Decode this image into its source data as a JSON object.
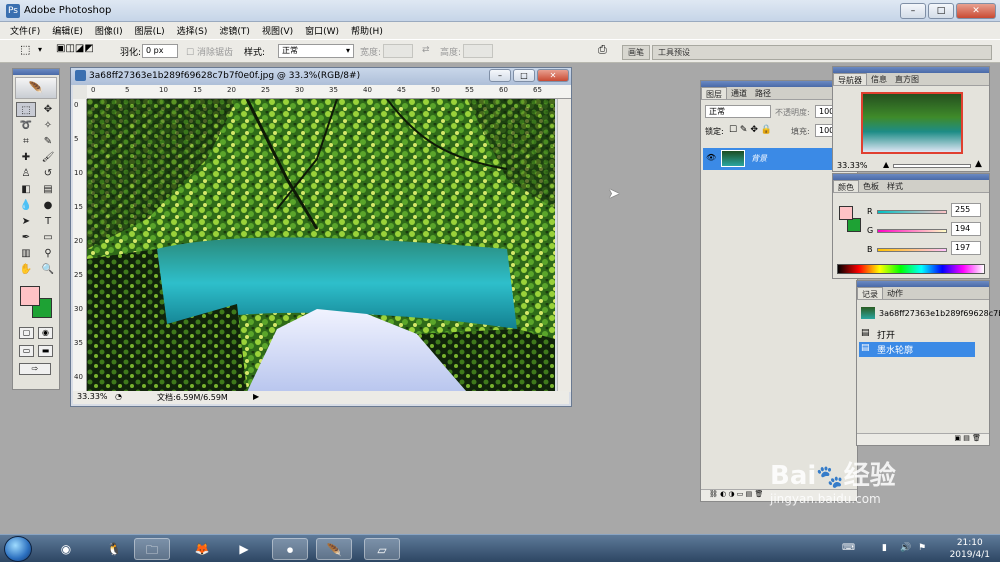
{
  "app": {
    "title": "Adobe Photoshop",
    "window_buttons": [
      "–",
      "□",
      "✕"
    ]
  },
  "menu": [
    "文件(F)",
    "编辑(E)",
    "图像(I)",
    "图层(L)",
    "选择(S)",
    "滤镜(T)",
    "视图(V)",
    "窗口(W)",
    "帮助(H)"
  ],
  "options": {
    "feather_label": "羽化:",
    "feather_value": "0 px",
    "antialias_label": "消除锯齿",
    "style_label": "样式:",
    "style_value": "正常",
    "width_label": "宽度:",
    "height_label": "高度:",
    "wells": [
      "画笔",
      "工具预设"
    ]
  },
  "document": {
    "title": "3a68ff27363e1b289f69628c7b7f0e0f.jpg @ 33.3%(RGB/8#)",
    "zoom": "33.33%",
    "doc_info": "文档:6.59M/6.59M",
    "ruler_h": [
      "0",
      "5",
      "10",
      "15",
      "20",
      "25",
      "30",
      "35",
      "40",
      "45",
      "50",
      "55",
      "60",
      "65"
    ],
    "ruler_v": [
      "0",
      "5",
      "10",
      "15",
      "20",
      "25",
      "30",
      "35",
      "40"
    ]
  },
  "layers_panel": {
    "tabs": [
      "图层",
      "通道",
      "路径"
    ],
    "blend_mode": "正常",
    "opacity_label": "不透明度:",
    "opacity_value": "100",
    "lock_label": "锁定:",
    "fill_label": "填充:",
    "fill_value": "100",
    "layer_name": "背景"
  },
  "navigator_panel": {
    "tabs": [
      "导航器",
      "信息",
      "直方图"
    ],
    "zoom": "33.33%"
  },
  "color_panel": {
    "tabs": [
      "颜色",
      "色板",
      "样式"
    ],
    "r_label": "R",
    "r_value": "255",
    "g_label": "G",
    "g_value": "194",
    "b_label": "B",
    "b_value": "197",
    "foreground": "#ffc2c5",
    "background": "#1ea234"
  },
  "history_panel": {
    "tabs": [
      "记录",
      "动作"
    ],
    "snapshot": "3a68ff27363e1b289f69628c7b7f0e0f...",
    "items": [
      "打开",
      "墨水轮廓"
    ]
  },
  "taskbar": {
    "time": "21:10",
    "date": "2019/4/1"
  },
  "watermark": {
    "brand": "Bai",
    "brand2": "经验",
    "url": "jingyan.baidu.com"
  }
}
